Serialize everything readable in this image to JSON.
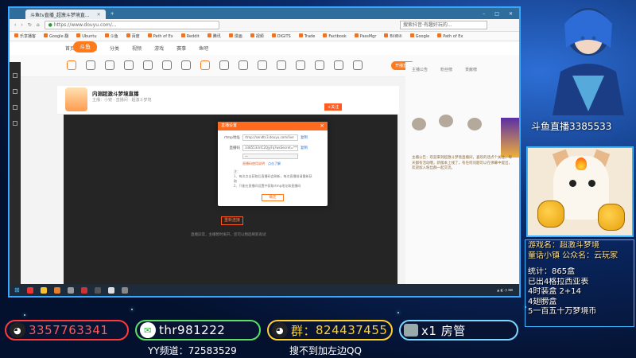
{
  "browser": {
    "tab_title": "斗鱼tv直播_超激斗梦境直...",
    "address": "https://www.douyu.com/...",
    "search_placeholder": "搜索抖音·有趣好玩的...",
    "bookmarks": [
      "乐享播客",
      "Google 翻",
      "Ubuntu",
      "斗鱼",
      "百度",
      "Path of Ex",
      "Reddit",
      "腾讯",
      "漫画",
      "视频",
      "DIGITS",
      "Trade",
      "Factbook",
      "PassMgr",
      "BiliBili",
      "Google",
      "Path of Ex"
    ]
  },
  "site": {
    "logo": "斗鱼",
    "nav": [
      "首页",
      "直播",
      "分类",
      "视频",
      "游戏",
      "赛事",
      "鱼吧"
    ],
    "start_live": "开播直播"
  },
  "room": {
    "title": "内测超激斗梦境直播",
    "subtitle": "主播：小镜  ·  直播间  ·  超激斗梦境",
    "follow": "+关注"
  },
  "dialog": {
    "title": "直播设置",
    "rtmp_label": "rtmp地址",
    "rtmp_value": "rtmp://sendtc3.douyu.com/live",
    "code_label": "直播码",
    "code_value": "3385533rlC2QyjFq?wsSecret=******",
    "copy": "复制",
    "select_value": "一",
    "link_text": "直播码使用说明",
    "link_more": "点击了解",
    "notes": "注：\n1、每次点击获取后直播码会刷新，每次直播前请重新获取\n2、只能在直播间设置中获取rtmp地址和直播码",
    "ok": "确定"
  },
  "player": {
    "err_button": "重新连接",
    "err_text": "直播异常，主播暂时离开，您可以稍后刷新再试"
  },
  "right_panel": {
    "tabs": [
      "主播公告",
      "粉丝榜",
      "贡献榜"
    ],
    "text": "主播公告：欢迎来到超激斗梦境直播间，喜欢的话点个关注，每天都有活动哦，新版本上线了，有任何问题可以在弹幕中提出，欢迎加入粉丝群一起交流。"
  },
  "overlay": {
    "douyu_room": "斗鱼直播3385533",
    "game_name": "游戏名：超激斗梦境",
    "host": "童话小镇  公众名：云玩家",
    "stats": [
      "统计：865盒",
      "已出4格拉西亚表",
      "4时装盒  2+14",
      "4翅膀盒",
      "5一百五十万梦境币"
    ],
    "qq": "3357763341",
    "wechat": "thr981222",
    "qun_label": "群：",
    "qun": "824437455",
    "admin": "x1 房管",
    "yy_channel": "YY频道：72583529",
    "search_tip": "搜不到加左边QQ"
  },
  "colors": {
    "overlay_bg": "#0b2b6b",
    "accent_blue": "#3bb6ff",
    "douyu_orange": "#ff7a1a",
    "qq_red": "#ff3a3a",
    "wechat_green": "#5ae063",
    "qun_yellow": "#ffd12d"
  }
}
